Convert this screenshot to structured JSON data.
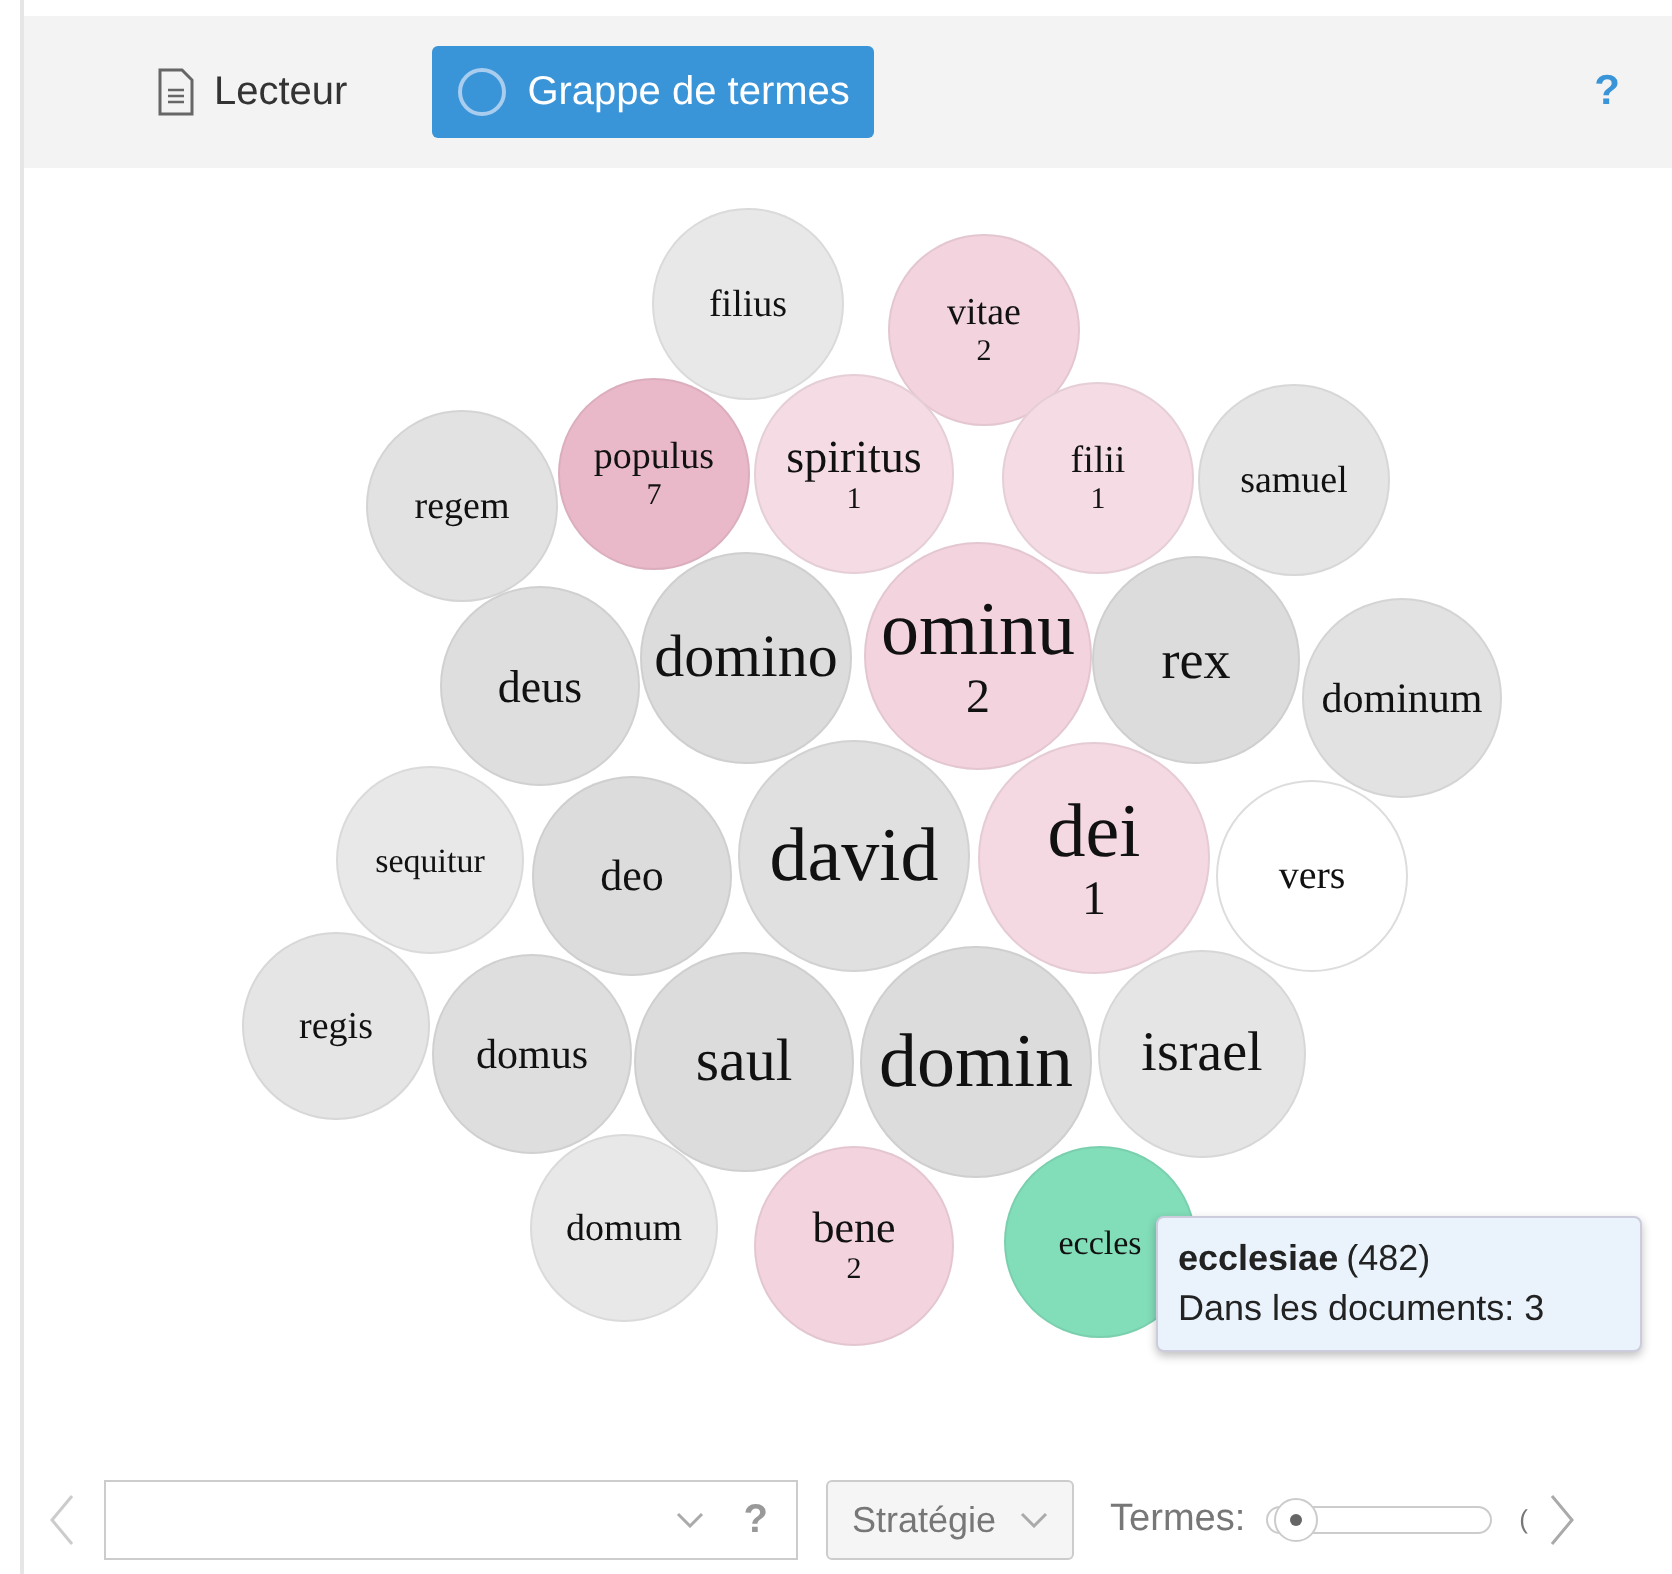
{
  "tabs": [
    {
      "label": "Lecteur",
      "selected": false
    },
    {
      "label": "Grappe de termes",
      "selected": true
    }
  ],
  "help": "?",
  "bubbles": [
    {
      "term": "filius",
      "color": "#e8e8e8"
    },
    {
      "term": "vitae",
      "count": "2",
      "color": "#f2d3de"
    },
    {
      "term": "regem",
      "color": "#e2e2e2"
    },
    {
      "term": "populus",
      "count": "7",
      "color": "#e9b9ca"
    },
    {
      "term": "spiritus",
      "count": "1",
      "color": "#f4dbe4"
    },
    {
      "term": "filii",
      "count": "1",
      "color": "#f4dbe4"
    },
    {
      "term": "samuel",
      "color": "#e5e5e5"
    },
    {
      "term": "deus",
      "color": "#dedede"
    },
    {
      "term": "domino",
      "color": "#dcdcdc"
    },
    {
      "term": "ominu",
      "count": "2",
      "color": "#f2d3de"
    },
    {
      "term": "rex",
      "color": "#dcdcdc"
    },
    {
      "term": "dominum",
      "color": "#e2e2e2"
    },
    {
      "term": "sequitur",
      "color": "#e8e8e8"
    },
    {
      "term": "deo",
      "color": "#dcdcdc"
    },
    {
      "term": "david",
      "color": "#e0e0e0"
    },
    {
      "term": "dei",
      "count": "1",
      "color": "#f4d8e2"
    },
    {
      "term": "vers",
      "color": "#ffffff"
    },
    {
      "term": "regis",
      "color": "#e5e5e5"
    },
    {
      "term": "domus",
      "color": "#dedede"
    },
    {
      "term": "saul",
      "color": "#dcdcdc"
    },
    {
      "term": "domin",
      "color": "#dcdcdc"
    },
    {
      "term": "israel",
      "color": "#e5e5e5"
    },
    {
      "term": "domum",
      "color": "#e8e8e8"
    },
    {
      "term": "bene",
      "count": "2",
      "color": "#f2d3de"
    },
    {
      "term": "eccles",
      "color": "#82ddb9"
    }
  ],
  "tooltip": {
    "term": "ecclesiae",
    "frequency": "(482)",
    "documents": "Dans les documents: 3"
  },
  "toolbar": {
    "query_help": "?",
    "strategy": "Stratégie",
    "terms_label": "Termes:",
    "terms": {
      "level": 0.08
    },
    "terms_value": "("
  }
}
